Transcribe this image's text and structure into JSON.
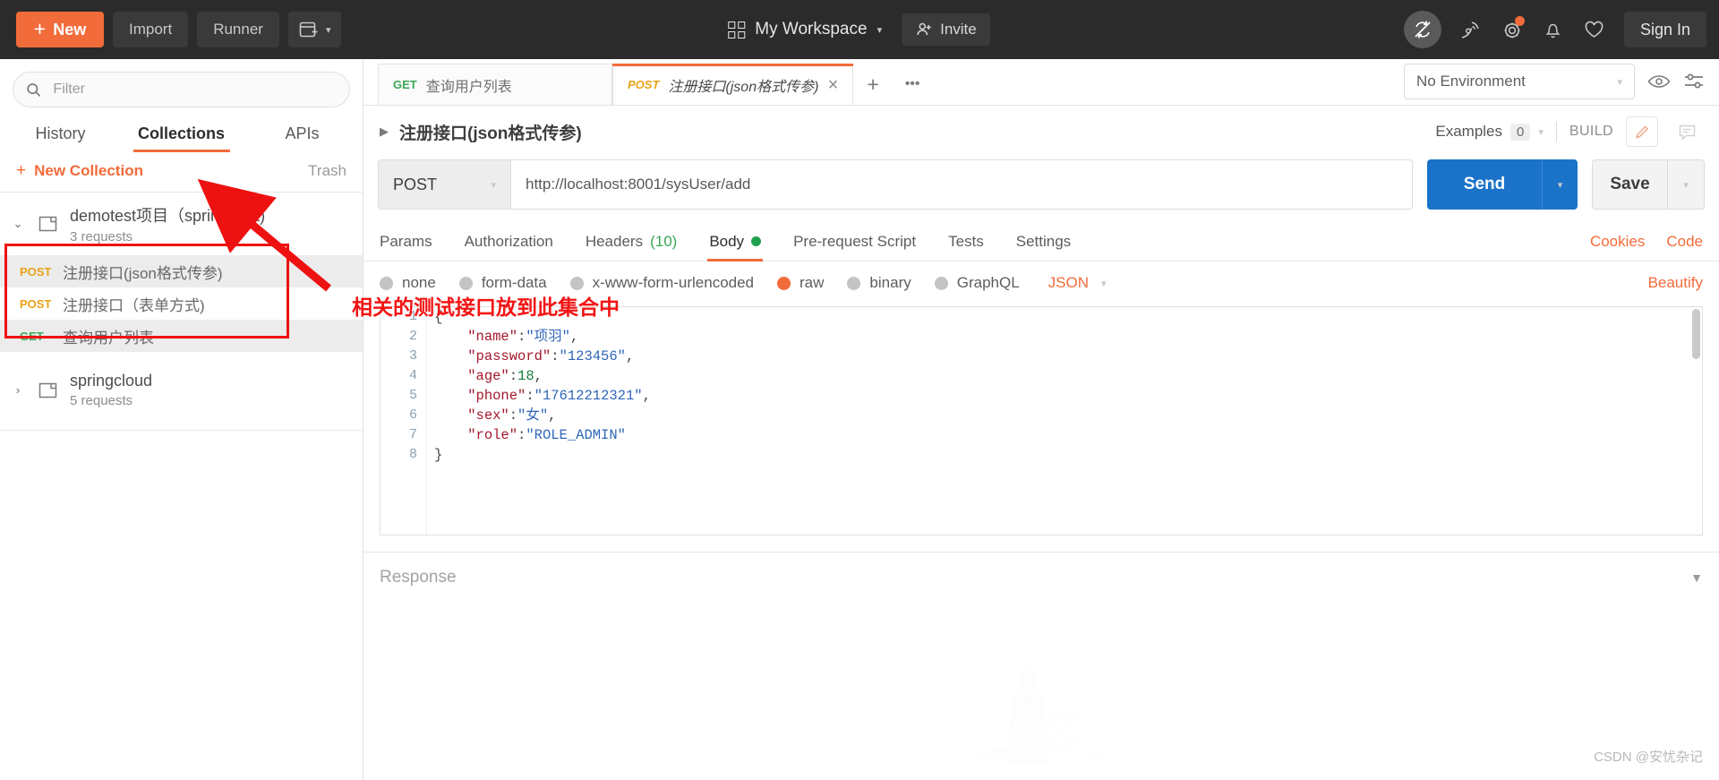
{
  "topbar": {
    "new_label": "New",
    "import_label": "Import",
    "runner_label": "Runner",
    "workspace_label": "My Workspace",
    "invite_label": "Invite",
    "signin_label": "Sign In",
    "icons": {
      "new_window": "new-window-icon",
      "sync_off": "sync-off-icon",
      "satellite": "satellite-icon",
      "gear": "gear-icon",
      "bell": "bell-icon",
      "heart": "heart-icon"
    },
    "accent_color": "#f26b3a",
    "background_color": "#2b2b2b"
  },
  "sidebar": {
    "filter_placeholder": "Filter",
    "filter_value": "",
    "tabs": [
      {
        "label": "History",
        "active": false
      },
      {
        "label": "Collections",
        "active": true
      },
      {
        "label": "APIs",
        "active": false
      }
    ],
    "new_collection_label": "New Collection",
    "trash_label": "Trash",
    "collections": [
      {
        "name": "demotest项目（springboot)",
        "requests_count": "3 requests",
        "expanded": true,
        "items": [
          {
            "method": "POST",
            "name": "注册接口(json格式传参)",
            "selected": true
          },
          {
            "method": "POST",
            "name": "注册接口（表单方式)",
            "selected": false
          },
          {
            "method": "GET",
            "name": "查询用户列表",
            "selected": true
          }
        ]
      },
      {
        "name": "springcloud",
        "requests_count": "5 requests",
        "expanded": false,
        "items": []
      }
    ]
  },
  "annotation": {
    "text": "相关的测试接口放到此集合中",
    "color": "#f31414"
  },
  "main": {
    "tabs": [
      {
        "method": "GET",
        "name": "查询用户列表",
        "active": false
      },
      {
        "method": "POST",
        "name": "注册接口(json格式传参)",
        "active": true
      }
    ],
    "add_tab_label": "+",
    "more_label": "•••",
    "environment": {
      "selected": "No Environment",
      "eye_icon": "eye-icon",
      "settings_icon": "sliders-icon"
    },
    "request": {
      "title": "注册接口(json格式传参)",
      "examples_label": "Examples",
      "examples_count": "0",
      "build_label": "BUILD",
      "edit_icon": "pencil-icon",
      "comment_icon": "comment-icon",
      "method": "POST",
      "url": "http://localhost:8001/sysUser/add",
      "send_label": "Send",
      "save_label": "Save"
    },
    "request_tabs": [
      {
        "label": "Params",
        "active": false,
        "badge": ""
      },
      {
        "label": "Authorization",
        "active": false,
        "badge": ""
      },
      {
        "label": "Headers",
        "active": false,
        "badge": "(10)"
      },
      {
        "label": "Body",
        "active": true,
        "badge": ""
      },
      {
        "label": "Pre-request Script",
        "active": false,
        "badge": ""
      },
      {
        "label": "Tests",
        "active": false,
        "badge": ""
      },
      {
        "label": "Settings",
        "active": false,
        "badge": ""
      }
    ],
    "cookies_label": "Cookies",
    "code_label": "Code",
    "body_types": [
      {
        "label": "none",
        "selected": false
      },
      {
        "label": "form-data",
        "selected": false
      },
      {
        "label": "x-www-form-urlencoded",
        "selected": false
      },
      {
        "label": "raw",
        "selected": true
      },
      {
        "label": "binary",
        "selected": false
      },
      {
        "label": "GraphQL",
        "selected": false
      }
    ],
    "raw_format": "JSON",
    "beautify_label": "Beautify",
    "editor": {
      "line_numbers": [
        "1",
        "2",
        "3",
        "4",
        "5",
        "6",
        "7",
        "8"
      ],
      "json": {
        "name": "项羽",
        "password": "123456",
        "age": 18,
        "phone": "17612212321",
        "sex": "女",
        "role": "ROLE_ADMIN"
      }
    },
    "response_label": "Response"
  },
  "watermark": "CSDN @安忧杂记"
}
